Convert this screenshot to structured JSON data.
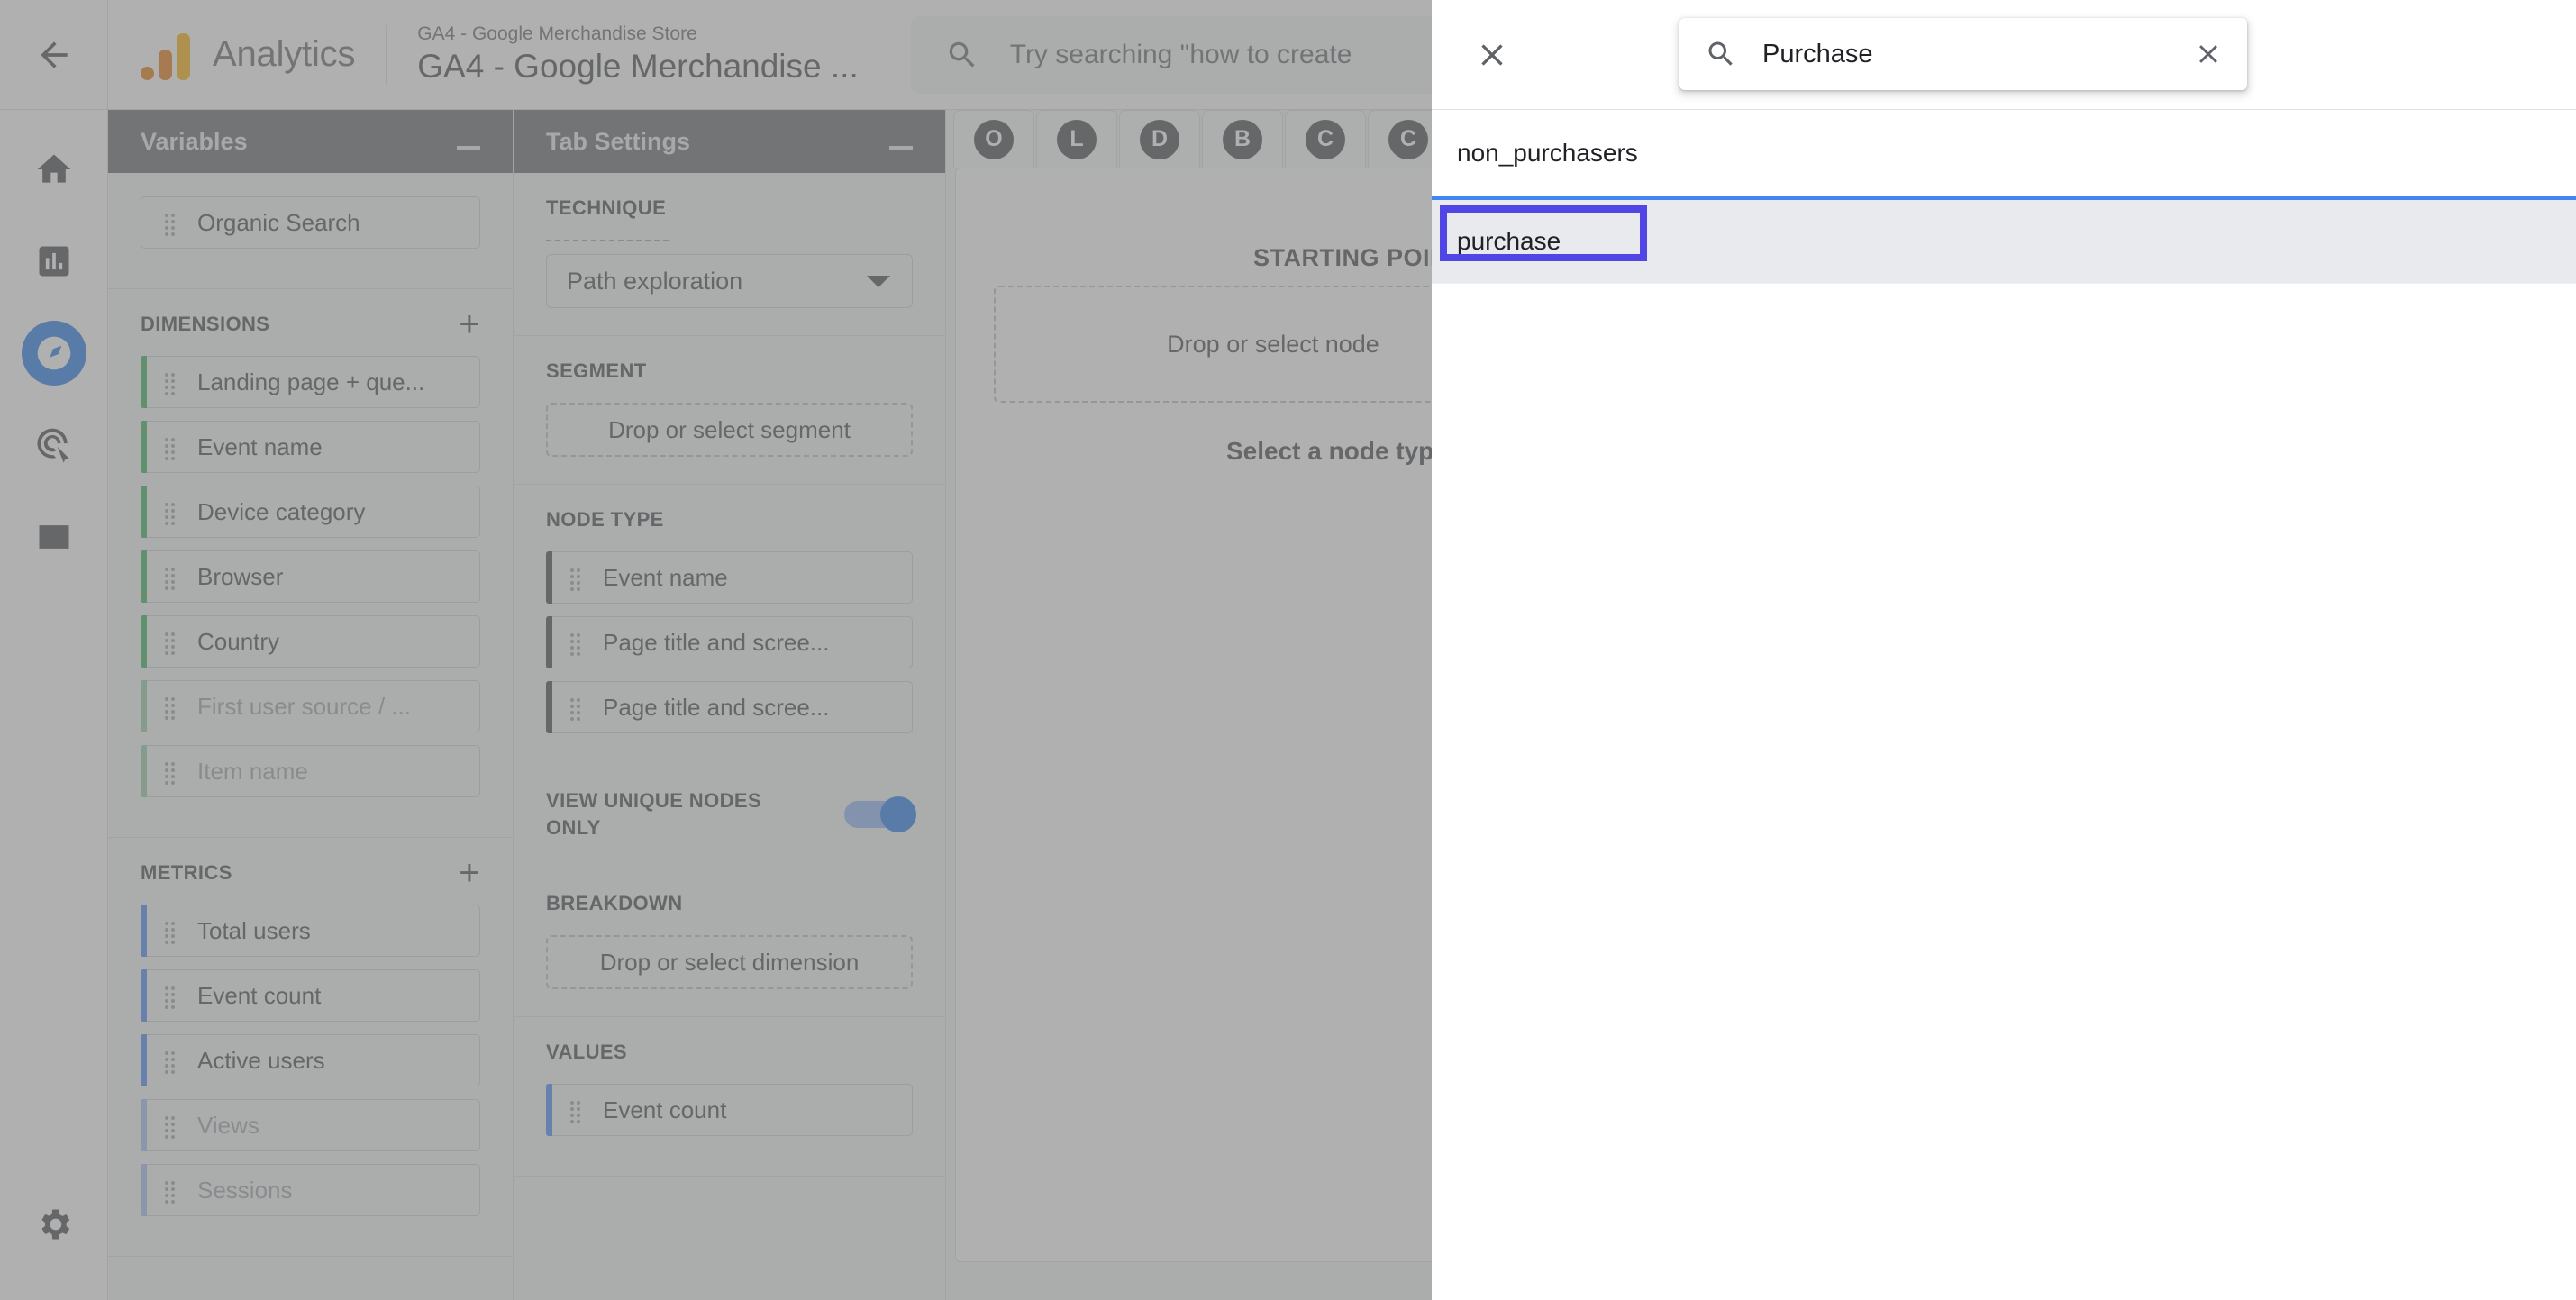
{
  "topbar": {
    "back_icon": "arrow-left-icon",
    "brand": "Analytics",
    "property_sub": "GA4 - Google Merchandise Store",
    "property_title": "GA4 - Google Merchandise ...",
    "search_icon": "search-icon",
    "search_placeholder": "Try searching \"how to create"
  },
  "navrail": {
    "items": [
      {
        "name": "home",
        "icon": "home-icon",
        "active": false
      },
      {
        "name": "reports",
        "icon": "bar-chart-icon",
        "active": false
      },
      {
        "name": "explore",
        "icon": "explore-icon",
        "active": true
      },
      {
        "name": "advertising",
        "icon": "target-cursor-icon",
        "active": false
      },
      {
        "name": "configure",
        "icon": "list-icon",
        "active": false
      }
    ],
    "settings_icon": "gear-icon"
  },
  "variables_panel": {
    "title": "Variables",
    "collapse_icon": "minimize-icon",
    "exploration_name": "Organic Search",
    "dimensions": {
      "label": "DIMENSIONS",
      "add_icon": "plus-icon",
      "items": [
        {
          "label": "Landing page + que...",
          "disabled": false
        },
        {
          "label": "Event name",
          "disabled": false
        },
        {
          "label": "Device category",
          "disabled": false
        },
        {
          "label": "Browser",
          "disabled": false
        },
        {
          "label": "Country",
          "disabled": false
        },
        {
          "label": "First user source / ...",
          "disabled": true
        },
        {
          "label": "Item name",
          "disabled": true
        }
      ]
    },
    "metrics": {
      "label": "METRICS",
      "add_icon": "plus-icon",
      "items": [
        {
          "label": "Total users",
          "disabled": false
        },
        {
          "label": "Event count",
          "disabled": false
        },
        {
          "label": "Active users",
          "disabled": false
        },
        {
          "label": "Views",
          "disabled": true
        },
        {
          "label": "Sessions",
          "disabled": true
        }
      ]
    }
  },
  "tab_settings_panel": {
    "title": "Tab Settings",
    "collapse_icon": "minimize-icon",
    "technique": {
      "label": "TECHNIQUE",
      "value": "Path exploration",
      "caret_icon": "chevron-down-icon"
    },
    "segment": {
      "label": "SEGMENT",
      "placeholder": "Drop or select segment"
    },
    "node_type": {
      "label": "NODE TYPE",
      "items": [
        "Event name",
        "Page title and scree...",
        "Page title and scree..."
      ]
    },
    "view_unique_nodes": {
      "label": "VIEW UNIQUE NODES ONLY",
      "enabled": true
    },
    "breakdown": {
      "label": "BREAKDOWN",
      "placeholder": "Drop or select dimension"
    },
    "values": {
      "label": "VALUES",
      "items": [
        "Event count"
      ]
    }
  },
  "canvas": {
    "tabs": [
      "O",
      "L",
      "D",
      "B",
      "C",
      "C"
    ],
    "starting_point_label": "STARTING POINT",
    "starting_point_placeholder": "Drop or select node",
    "select_node_type": "Select a node type"
  },
  "modal": {
    "close_icon": "close-icon",
    "search": {
      "icon": "search-icon",
      "value": "Purchase",
      "clear_icon": "clear-icon"
    },
    "results": [
      {
        "label": "non_purchasers",
        "highlighted": false
      },
      {
        "label": "purchase",
        "highlighted": true
      }
    ]
  },
  "colors": {
    "accent_blue": "#1a73e8",
    "dimension_green": "#34a853",
    "metric_blue": "#4285f4",
    "annotation_purple": "#4f46e5",
    "row_highlight_bg": "#e8eaed"
  }
}
